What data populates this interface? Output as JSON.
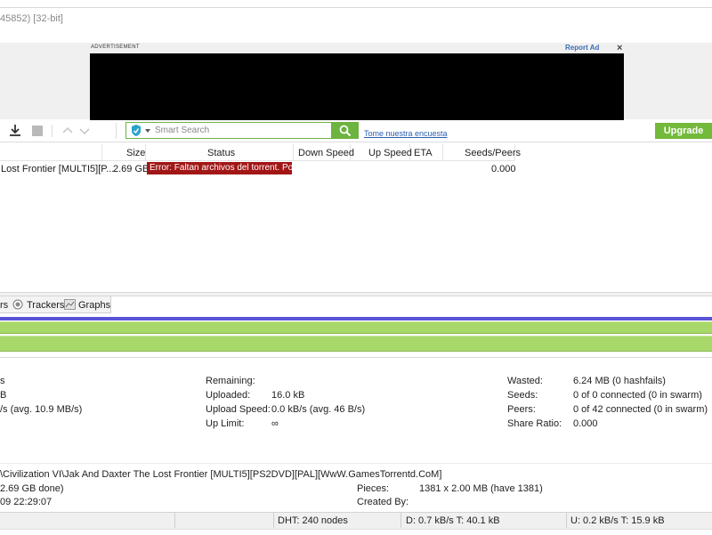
{
  "window": {
    "title": "45852) [32-bit]"
  },
  "ad": {
    "label": "ADVERTISEMENT",
    "report": "Report Ad",
    "close": "×"
  },
  "toolbar": {
    "search_placeholder": "Smart Search",
    "survey_link": "Tome nuestra encuesta",
    "upgrade_label": "Upgrade"
  },
  "list": {
    "columns": {
      "size": "Size",
      "status": "Status",
      "down": "Down Speed",
      "up": "Up Speed",
      "eta": "ETA",
      "seeds": "Seeds/Peers"
    },
    "rows": [
      {
        "name": "Lost Frontier [MULTI5][P...",
        "size": "2.69 GB",
        "status": "Error: Faltan archivos del torrent. Por f",
        "seeds": "0.000"
      }
    ]
  },
  "tabs": {
    "partial": "rs",
    "trackers": "Trackers",
    "graphs": "Graphs"
  },
  "transfer": {
    "left": {
      "l1": "s",
      "l2": "B",
      "l3": "/s (avg. 10.9 MB/s)"
    },
    "mid": {
      "remaining_label": "Remaining:",
      "uploaded_label": "Uploaded:",
      "uploaded_value": "16.0 kB",
      "upspeed_label": "Upload Speed:",
      "upspeed_value": "0.0 kB/s (avg. 46 B/s)",
      "uplimit_label": "Up Limit:",
      "uplimit_value": "∞"
    },
    "right": {
      "wasted_label": "Wasted:",
      "wasted_value": "6.24 MB (0 hashfails)",
      "seeds_label": "Seeds:",
      "seeds_value": "0 of 0 connected (0 in swarm)",
      "peers_label": "Peers:",
      "peers_value": "0 of 42 connected (0 in swarm)",
      "ratio_label": "Share Ratio:",
      "ratio_value": "0.000"
    }
  },
  "general": {
    "path": "\\Civilization VI\\Jak And Daxter The Lost Frontier [MULTI5][PS2DVD][PAL][WwW.GamesTorrentd.CoM]",
    "size_partial": "2.69 GB done)",
    "date_partial": "09 22:29:07",
    "pieces_label": "Pieces:",
    "pieces_value": "1381 x 2.00 MB (have 1381)",
    "created_label": "Created By:"
  },
  "statusbar": {
    "dht": "DHT: 240 nodes",
    "down": "D: 0.7 kB/s T: 40.1 kB",
    "up": "U: 0.2 kB/s T: 15.9 kB"
  },
  "colors": {
    "accent_green": "#73b93b",
    "error_red": "#a21616",
    "progress_green": "#a8d86a",
    "progress_blue": "#5a52d6"
  }
}
